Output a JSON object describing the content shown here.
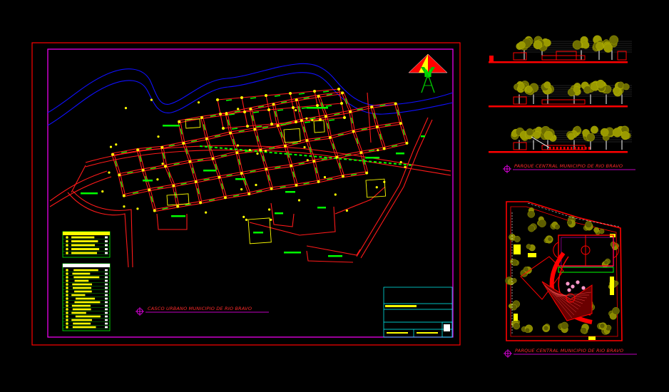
{
  "drawing": {
    "background": "#000000",
    "colors": {
      "frame": "#ff0000",
      "inner_frame": "#ff00ff",
      "river": "#0000ff",
      "streets": "#ff0000",
      "blocks": "#00ff00",
      "nodes": "#ffff00",
      "trees": "#808000",
      "title_block": "#00ffff"
    }
  },
  "main_plan": {
    "title": "CASCO URBANO   MUNICIPIO DE RIO BRAVO",
    "north_letter": "N"
  },
  "elevations": {
    "title": "PARQUE CENTRAL   MUNICIPIO DE RIO BRAVO"
  },
  "park_plan": {
    "title": "PARQUE CENTRAL  MUNICIPIO DE RIO BRAVO"
  },
  "icons": [
    "north-arrow-icon",
    "section-marker-icon"
  ]
}
